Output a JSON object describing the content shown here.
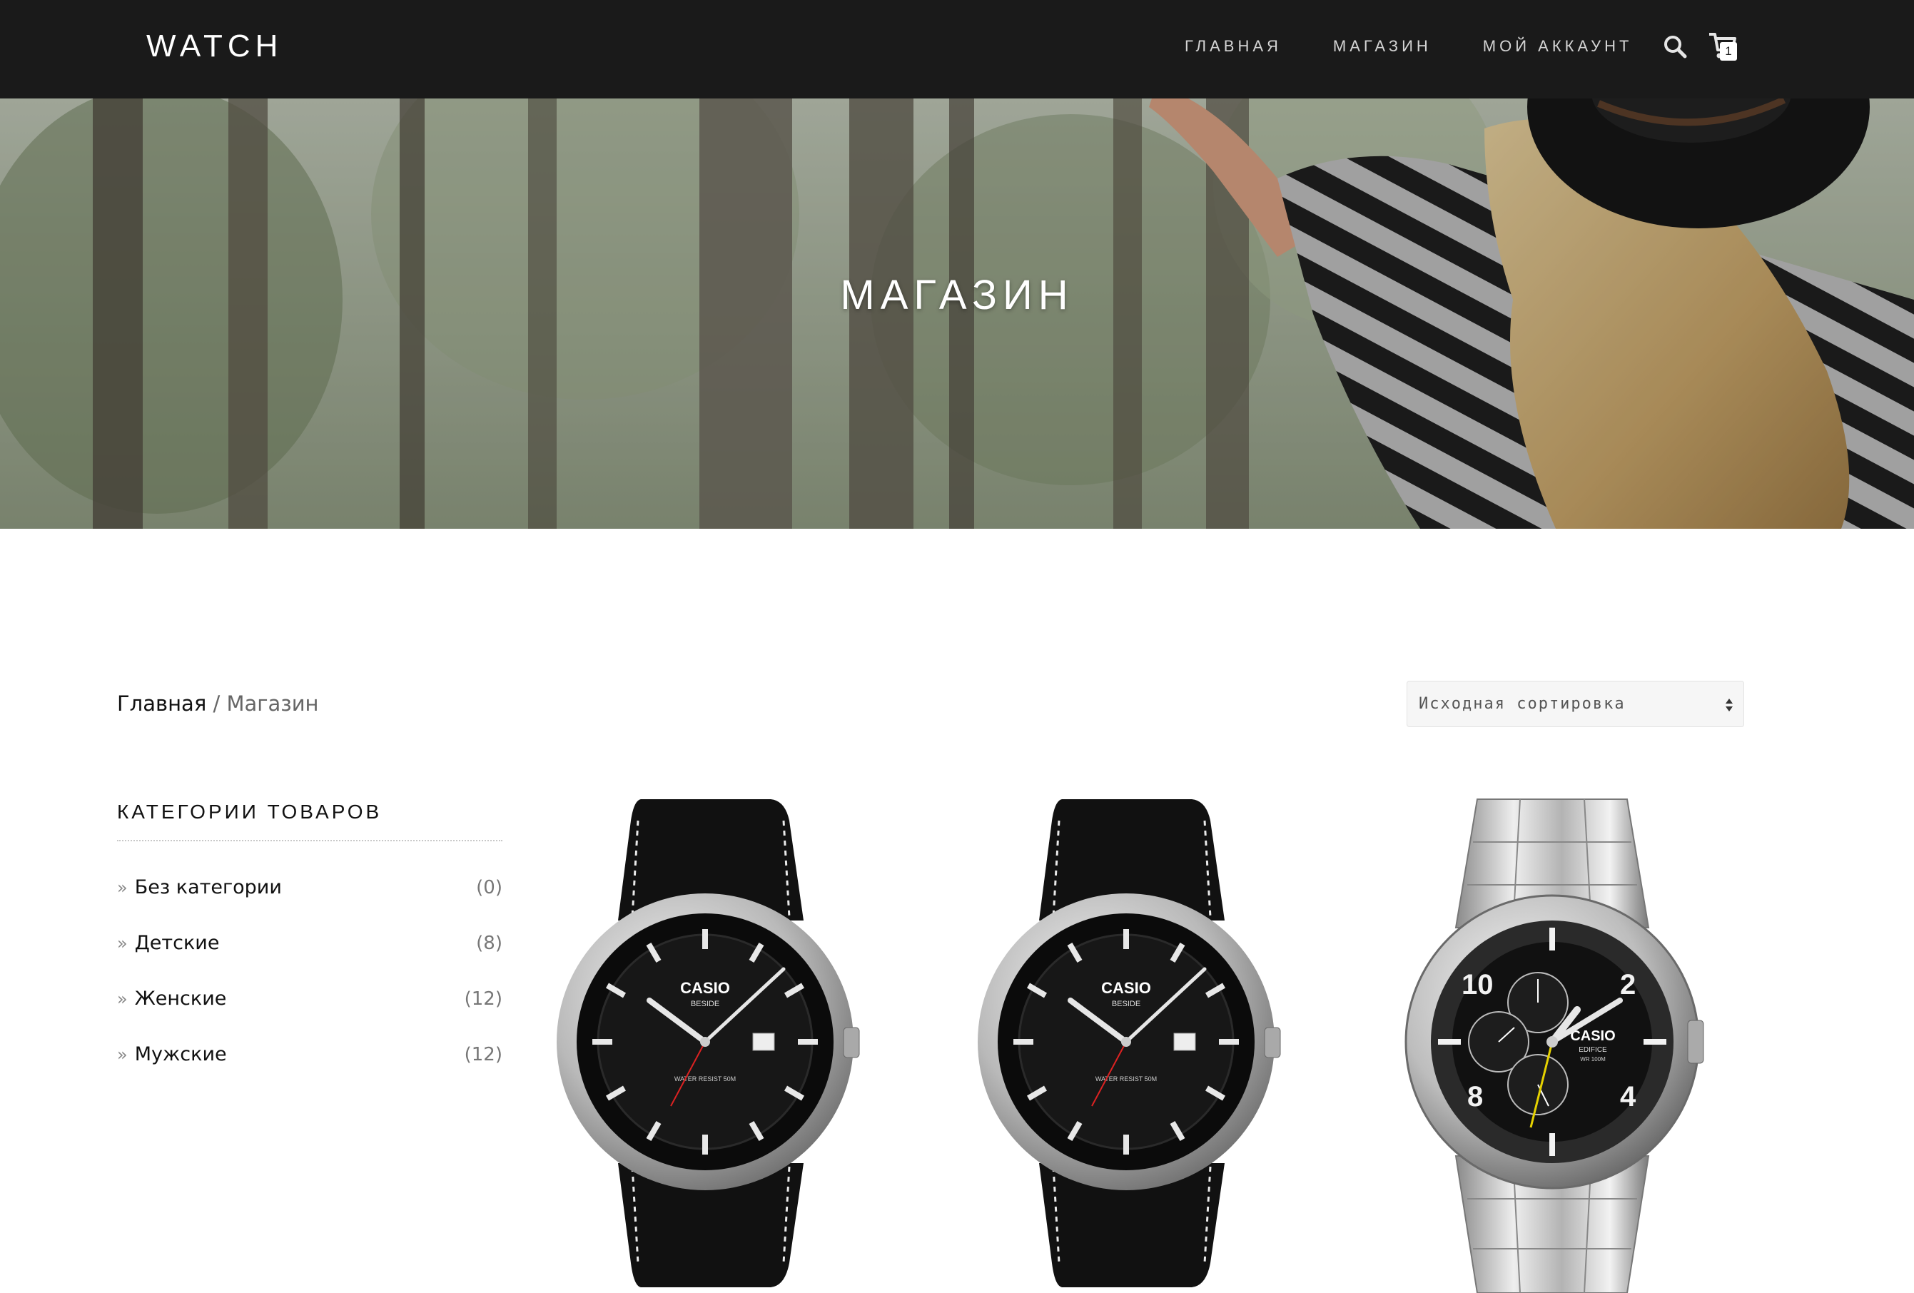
{
  "header": {
    "logo": "WATCH",
    "nav": [
      "ГЛАВНАЯ",
      "МАГАЗИН",
      "МОЙ АККАУНТ"
    ],
    "cart_count": "1"
  },
  "hero": {
    "title": "МАГАЗИН"
  },
  "breadcrumb": {
    "home": "Главная",
    "separator": " / ",
    "current": "Магазин"
  },
  "sort": {
    "selected": "Исходная сортировка"
  },
  "sidebar": {
    "title": "КАТЕГОРИИ ТОВАРОВ",
    "categories": [
      {
        "name": "Без категории",
        "count": "(0)"
      },
      {
        "name": "Детские",
        "count": "(8)"
      },
      {
        "name": "Женские",
        "count": "(12)"
      },
      {
        "name": "Мужские",
        "count": "(12)"
      }
    ]
  },
  "products": [
    {
      "brand": "CASIO",
      "model": "BESIDE",
      "detail": "WATER RESIST 50M",
      "strap": "leather"
    },
    {
      "brand": "CASIO",
      "model": "BESIDE",
      "detail": "WATER RESIST 50M",
      "strap": "leather"
    },
    {
      "brand": "CASIO",
      "model": "EDIFICE",
      "detail": "WR 100M",
      "strap": "steel"
    }
  ],
  "icons": {
    "search": "search-icon",
    "cart": "cart-icon",
    "category_chevron": "»"
  },
  "colors": {
    "topbar": "#1a1a1a",
    "nav_text": "#d4d4d4",
    "hero_text": "#ffffff",
    "text_dark": "#111111",
    "text_muted": "#777777"
  }
}
